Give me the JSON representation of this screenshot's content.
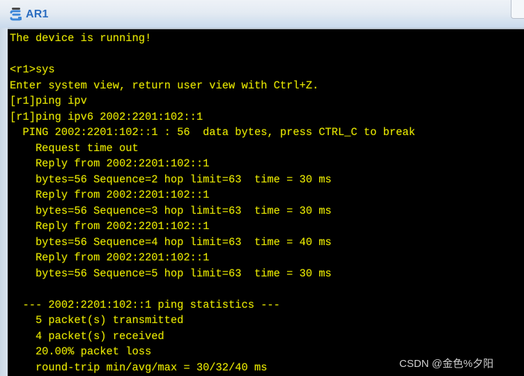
{
  "window": {
    "title": "AR1",
    "icon": "router-icon"
  },
  "terminal": {
    "lines": [
      "The device is running!",
      "",
      "<r1>sys",
      "Enter system view, return user view with Ctrl+Z.",
      "[r1]ping ipv",
      "[r1]ping ipv6 2002:2201:102::1",
      "  PING 2002:2201:102::1 : 56  data bytes, press CTRL_C to break",
      "    Request time out",
      "    Reply from 2002:2201:102::1",
      "    bytes=56 Sequence=2 hop limit=63  time = 30 ms",
      "    Reply from 2002:2201:102::1",
      "    bytes=56 Sequence=3 hop limit=63  time = 30 ms",
      "    Reply from 2002:2201:102::1",
      "    bytes=56 Sequence=4 hop limit=63  time = 40 ms",
      "    Reply from 2002:2201:102::1",
      "    bytes=56 Sequence=5 hop limit=63  time = 30 ms",
      "",
      "  --- 2002:2201:102::1 ping statistics ---",
      "    5 packet(s) transmitted",
      "    4 packet(s) received",
      "    20.00% packet loss",
      "    round-trip min/avg/max = 30/32/40 ms"
    ],
    "text_color": "#e1e100",
    "background": "#000000"
  },
  "watermark": "CSDN @金色%夕阳"
}
